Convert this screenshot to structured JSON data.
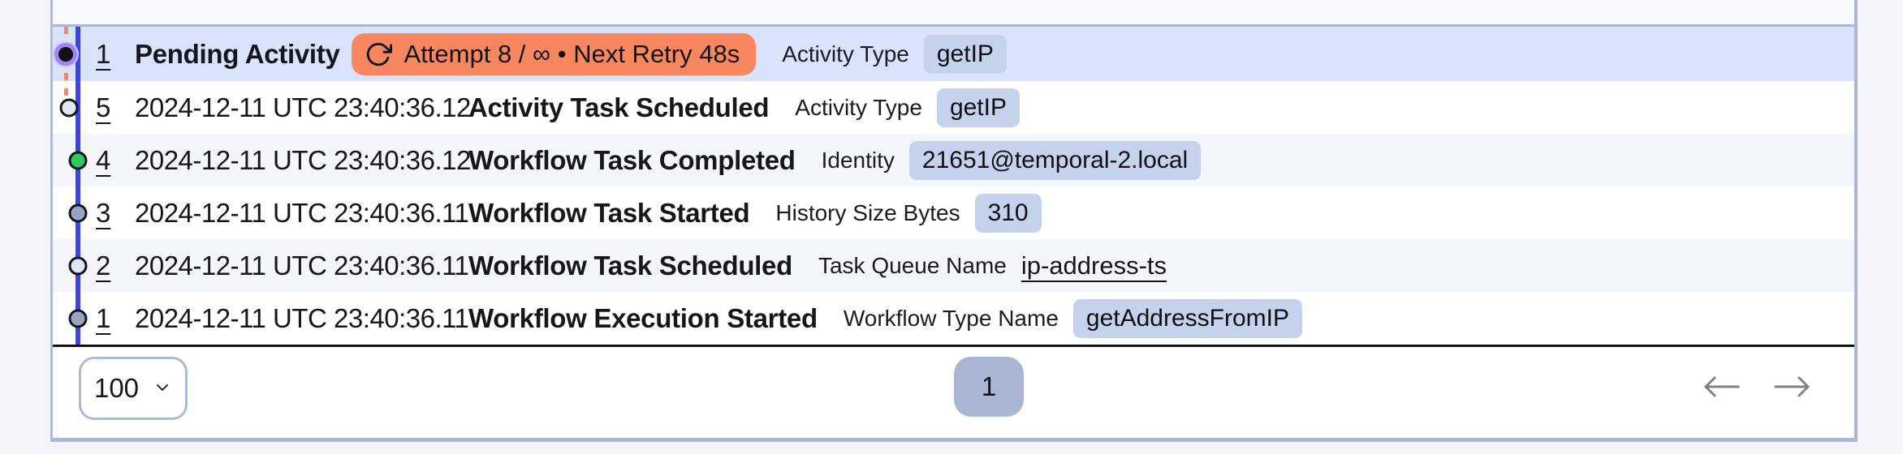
{
  "events": [
    {
      "number": "1",
      "title": "Pending Activity",
      "retry_badge_text": "Attempt 8 / ∞ • Next Retry 48s",
      "attr_label": "Activity Type",
      "attr_value": "getIP"
    },
    {
      "number": "5",
      "timestamp": "2024-12-11 UTC 23:40:36.12",
      "title": "Activity Task Scheduled",
      "attr_label": "Activity Type",
      "attr_value": "getIP"
    },
    {
      "number": "4",
      "timestamp": "2024-12-11 UTC 23:40:36.12",
      "title": "Workflow Task Completed",
      "attr_label": "Identity",
      "attr_value": "21651@temporal-2.local"
    },
    {
      "number": "3",
      "timestamp": "2024-12-11 UTC 23:40:36.11",
      "title": "Workflow Task Started",
      "attr_label": "History Size Bytes",
      "attr_value": "310"
    },
    {
      "number": "2",
      "timestamp": "2024-12-11 UTC 23:40:36.11",
      "title": "Workflow Task Scheduled",
      "attr_label": "Task Queue Name",
      "attr_value": "ip-address-ts"
    },
    {
      "number": "1",
      "timestamp": "2024-12-11 UTC 23:40:36.11",
      "title": "Workflow Execution Started",
      "attr_label": "Workflow Type Name",
      "attr_value": "getAddressFromIP"
    }
  ],
  "pagination": {
    "page_size": "100",
    "current_page": "1"
  },
  "icons": {
    "retry": "rotate-clockwise",
    "page_size_chevron": "chevron-down",
    "prev": "arrow-left",
    "next": "arrow-right"
  },
  "colors": {
    "retry_badge_bg": "#f8875f",
    "pending_row_bg": "#d9e3fb",
    "chip_bg": "#c5d2ec",
    "timeline_line": "#3b44df",
    "pending_dashed_line": "#f8875f",
    "dot_green": "#2bcb5e",
    "dot_gray": "#97a6c0",
    "dot_light": "#dfe6f7",
    "dot_pending_ring": "#9d86ee",
    "page_button_bg": "#a9b6d3"
  }
}
